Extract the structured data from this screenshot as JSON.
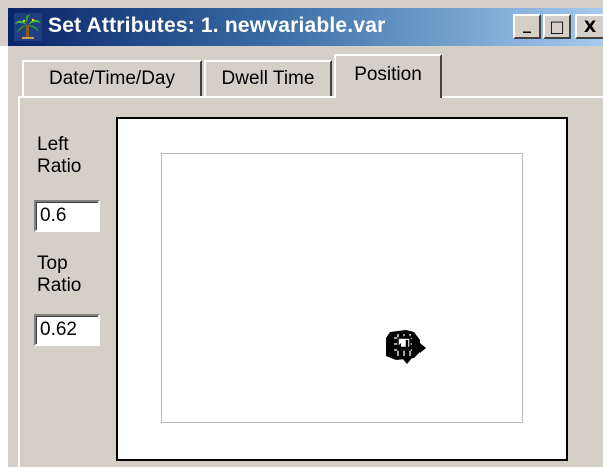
{
  "window": {
    "title": "Set Attributes: 1. newvariable.var",
    "controls": {
      "minimize": "_",
      "maximize": "□",
      "close": "X"
    }
  },
  "tabs": [
    {
      "label": "Date/Time/Day",
      "selected": false
    },
    {
      "label": "Dwell Time",
      "selected": false
    },
    {
      "label": "Position",
      "selected": true
    }
  ],
  "position": {
    "left_ratio_label_line1": "Left",
    "left_ratio_label_line2": "Ratio",
    "left_ratio_value": "0.6",
    "top_ratio_label_line1": "Top",
    "top_ratio_label_line2": "Ratio",
    "top_ratio_value": "0.62"
  },
  "icons": {
    "app": "palm-tree-icon",
    "cursor": "move-cursor-icon"
  }
}
